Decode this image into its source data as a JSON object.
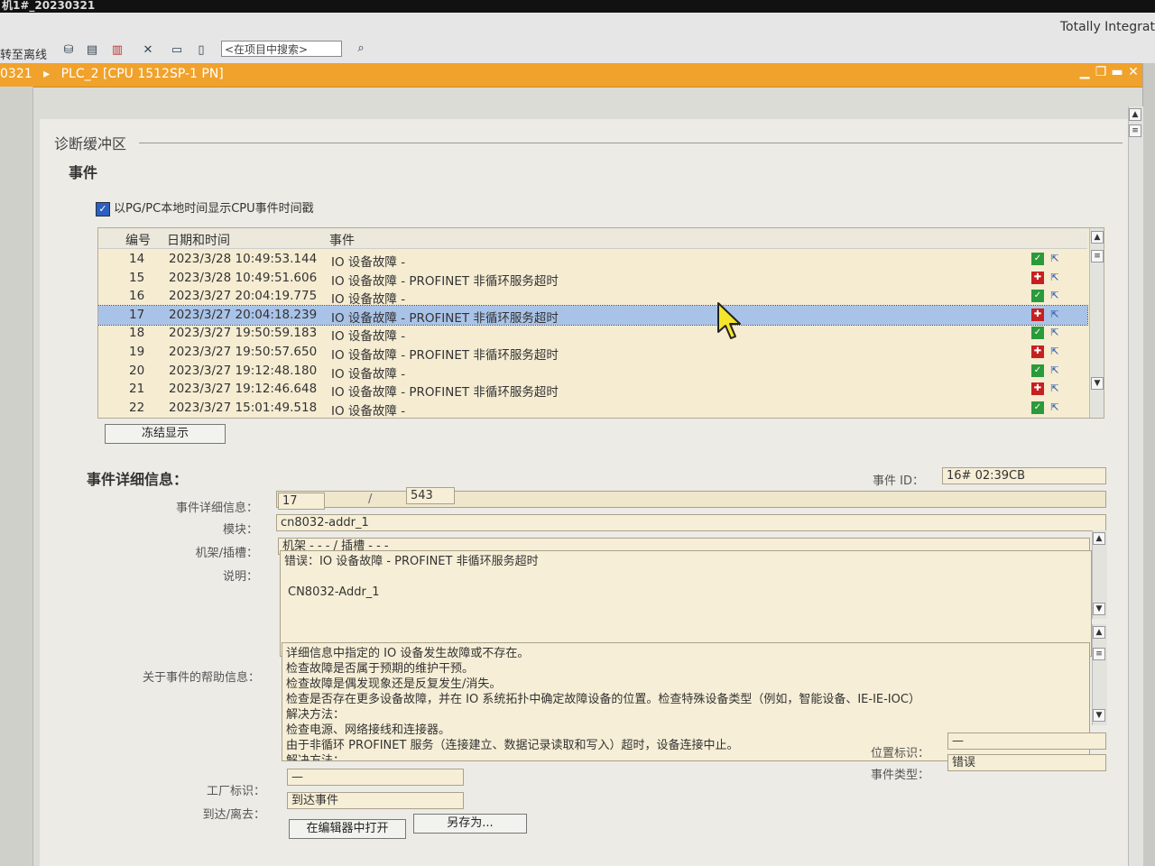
{
  "window": {
    "title": "机1#_20230321",
    "brand": "Totally Integrat"
  },
  "toolbar": {
    "go_offline": "转至离线",
    "search_placeholder": "<在项目中搜索>",
    "icons": [
      "accessible-devices-icon",
      "module-icon",
      "layout-icon",
      "close-view-icon",
      "split-horizontal-icon",
      "split-vertical-icon",
      "binoculars-icon"
    ]
  },
  "breadcrumb": {
    "project": "0321",
    "separator": "▸",
    "device": "PLC_2 [CPU 1512SP-1 PN]"
  },
  "section": {
    "title": "诊断缓冲区",
    "events_heading": "事件",
    "show_local_time_label": "以PG/PC本地时间显示CPU事件时间戳",
    "show_local_time_checked": true
  },
  "events_table": {
    "columns": [
      "编号",
      "日期和时间",
      "事件"
    ],
    "rows": [
      {
        "no": "14",
        "datetime": "2023/3/28 10:49:53.144",
        "event": "IO 设备故障 -",
        "status": "ok"
      },
      {
        "no": "15",
        "datetime": "2023/3/28 10:49:51.606",
        "event": "IO 设备故障 - PROFINET 非循环服务超时",
        "status": "error"
      },
      {
        "no": "16",
        "datetime": "2023/3/27 20:04:19.775",
        "event": "IO 设备故障 -",
        "status": "ok"
      },
      {
        "no": "17",
        "datetime": "2023/3/27 20:04:18.239",
        "event": "IO 设备故障 - PROFINET 非循环服务超时",
        "status": "error",
        "selected": true
      },
      {
        "no": "18",
        "datetime": "2023/3/27 19:50:59.183",
        "event": "IO 设备故障 -",
        "status": "ok"
      },
      {
        "no": "19",
        "datetime": "2023/3/27 19:50:57.650",
        "event": "IO 设备故障 - PROFINET 非循环服务超时",
        "status": "error"
      },
      {
        "no": "20",
        "datetime": "2023/3/27 19:12:48.180",
        "event": "IO 设备故障 -",
        "status": "ok"
      },
      {
        "no": "21",
        "datetime": "2023/3/27 19:12:46.648",
        "event": "IO 设备故障 - PROFINET 非循环服务超时",
        "status": "error"
      },
      {
        "no": "22",
        "datetime": "2023/3/27 15:01:49.518",
        "event": "IO 设备故障 -",
        "status": "ok"
      }
    ],
    "status_colors": {
      "ok": "#2a9a3a",
      "error": "#c62020"
    }
  },
  "freeze_button": "冻结显示",
  "details": {
    "heading": "事件详细信息：",
    "event_id_label": "事件 ID：",
    "event_id": "16# 02:39CB",
    "detail_label": "事件详细信息：",
    "detail_num": "17",
    "detail_sep": "/",
    "detail_total": "543",
    "module_label": "模块：",
    "module": "cn8032-addr_1",
    "rack_label": "机架/插槽：",
    "rack": "机架 - - - / 插槽 - - -",
    "desc_label": "说明：",
    "desc_lines": [
      "错误：IO 设备故障 - PROFINET 非循环服务超时",
      "",
      "CN8032-Addr_1"
    ],
    "help_label": "关于事件的帮助信息：",
    "help_lines": [
      "详细信息中指定的 IO 设备发生故障或不存在。",
      "检查故障是否属于预期的维护干预。",
      "检查故障是偶发现象还是反复发生/消失。",
      "检查是否存在更多设备故障，并在 IO 系统拓扑中确定故障设备的位置。检查特殊设备类型（例如，智能设备、IE-IE-IOC）",
      "解决方法：",
      "检查电源、网络接线和连接器。",
      " 由于非循环 PROFINET 服务（连接建立、数据记录读取和写入）超时，设备连接中止。",
      "解决方法："
    ],
    "plant_label": "工厂标识：",
    "plant": "—",
    "location_label": "位置标识：",
    "location": "—",
    "arrive_label": "到达/离去：",
    "arrive": "到达事件",
    "event_type_label": "事件类型：",
    "event_type": "错误"
  },
  "buttons": {
    "open_editor": "在编辑器中打开",
    "save_as": "另存为..."
  }
}
